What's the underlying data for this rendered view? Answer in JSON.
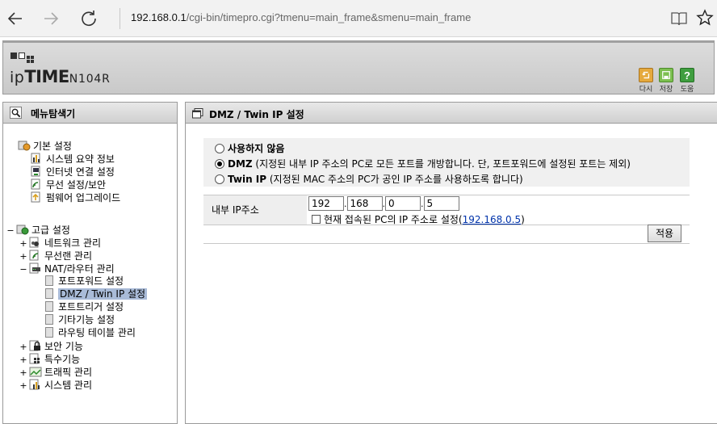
{
  "browser": {
    "url_host": "192.168.0.1",
    "url_path": "/cgi-bin/timepro.cgi?tmenu=main_frame&smenu=main_frame"
  },
  "header": {
    "logo_ip": "ip",
    "logo_time": "TIME",
    "logo_model": "N104R",
    "buttons": [
      {
        "label": "다시",
        "icon": "refresh-icon",
        "color": "#e0a23a"
      },
      {
        "label": "저장",
        "icon": "save-icon",
        "color": "#6aae44"
      },
      {
        "label": "도움",
        "icon": "help-icon",
        "color": "#3a9a3a"
      }
    ]
  },
  "menu": {
    "title": "메뉴탐색기",
    "basic": {
      "label": "기본 설정",
      "items": [
        "시스템 요약 정보",
        "인터넷 연결 설정",
        "무선 설정/보안",
        "펌웨어 업그레이드"
      ]
    },
    "advanced": {
      "label": "고급 설정",
      "toggle": "−",
      "groups": [
        {
          "label": "네트워크 관리",
          "toggle": "+"
        },
        {
          "label": "무선랜 관리",
          "toggle": "+"
        },
        {
          "label": "NAT/라우터 관리",
          "toggle": "−"
        }
      ],
      "nat_items": [
        "포트포워드 설정",
        "DMZ / Twin IP 설정",
        "포트트리거 설정",
        "기타기능 설정",
        "라우팅 테이블 관리"
      ],
      "other_groups": [
        {
          "label": "보안 기능",
          "toggle": "+"
        },
        {
          "label": "특수기능",
          "toggle": "+"
        },
        {
          "label": "트래픽 관리",
          "toggle": "+"
        },
        {
          "label": "시스템 관리",
          "toggle": "+"
        }
      ]
    }
  },
  "content": {
    "title": "DMZ / Twin IP 설정",
    "options": [
      {
        "label": "사용하지 않음",
        "desc": "",
        "selected": false
      },
      {
        "label": "DMZ",
        "desc": " (지정된 내부 IP 주소의 PC로 모든 포트를 개방합니다. 단, 포트포워드에 설정된 포트는 제외)",
        "selected": true
      },
      {
        "label": "Twin IP",
        "desc": " (지정된 MAC 주소의 PC가 공인 IP 주소를 사용하도록 합니다)",
        "selected": false
      }
    ],
    "ip_label": "내부 IP주소",
    "ip_octets": [
      "192",
      "168",
      "0",
      "5"
    ],
    "ip_separator": ".",
    "current_pc_label": "현재 접속된 PC의 IP 주소로 설정(",
    "current_pc_ip": "192.168.0.5",
    "current_pc_close": ")",
    "apply_label": "적용"
  }
}
